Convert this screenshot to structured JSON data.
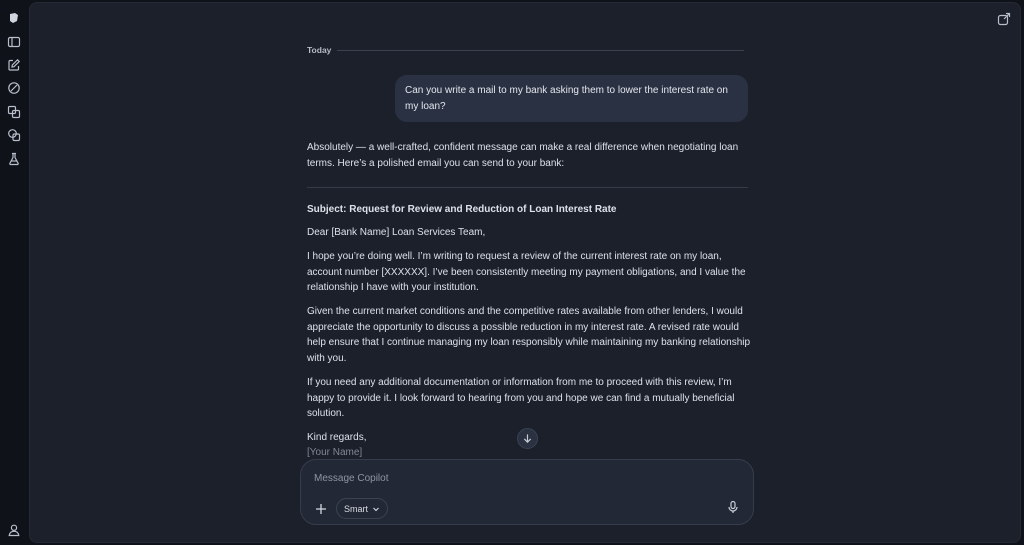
{
  "sidebar": {
    "icons": [
      "copilot-logo-icon",
      "sidebar-toggle-icon",
      "new-chat-icon",
      "discover-icon",
      "library-icon",
      "pages-icon",
      "labs-icon"
    ],
    "bottom_icon": "profile-icon"
  },
  "header": {
    "share_icon": "share-icon"
  },
  "chat": {
    "date_divider": "Today",
    "user_message": "Can you write a mail to my bank asking them to lower the interest rate on my loan?",
    "intro": "Absolutely — a well-crafted, confident message can make a real difference when negotiating loan terms. Here’s a polished email you can send to your bank:",
    "email": {
      "subject": "Subject: Request for Review and Reduction of Loan Interest Rate",
      "greeting": "Dear [Bank Name] Loan Services Team,",
      "p1": "I hope you’re doing well. I’m writing to request a review of the current interest rate on my loan, account number [XXXXXX]. I’ve been consistently meeting my payment obligations, and I value the relationship I have with your institution.",
      "p2": "Given the current market conditions and the competitive rates available from other lenders, I would appreciate the opportunity to discuss a possible reduction in my interest rate. A revised rate would help ensure that I continue managing my loan responsibly while maintaining my banking relationship with you.",
      "p3": "If you need any additional documentation or information from me to proceed with this review, I’m happy to provide it. I look forward to hearing from you and hope we can find a mutually beneficial solution.",
      "closing": "Kind regards,",
      "signature": "[Your Name]"
    }
  },
  "composer": {
    "placeholder": "Message Copilot",
    "mode_label": "Smart"
  }
}
